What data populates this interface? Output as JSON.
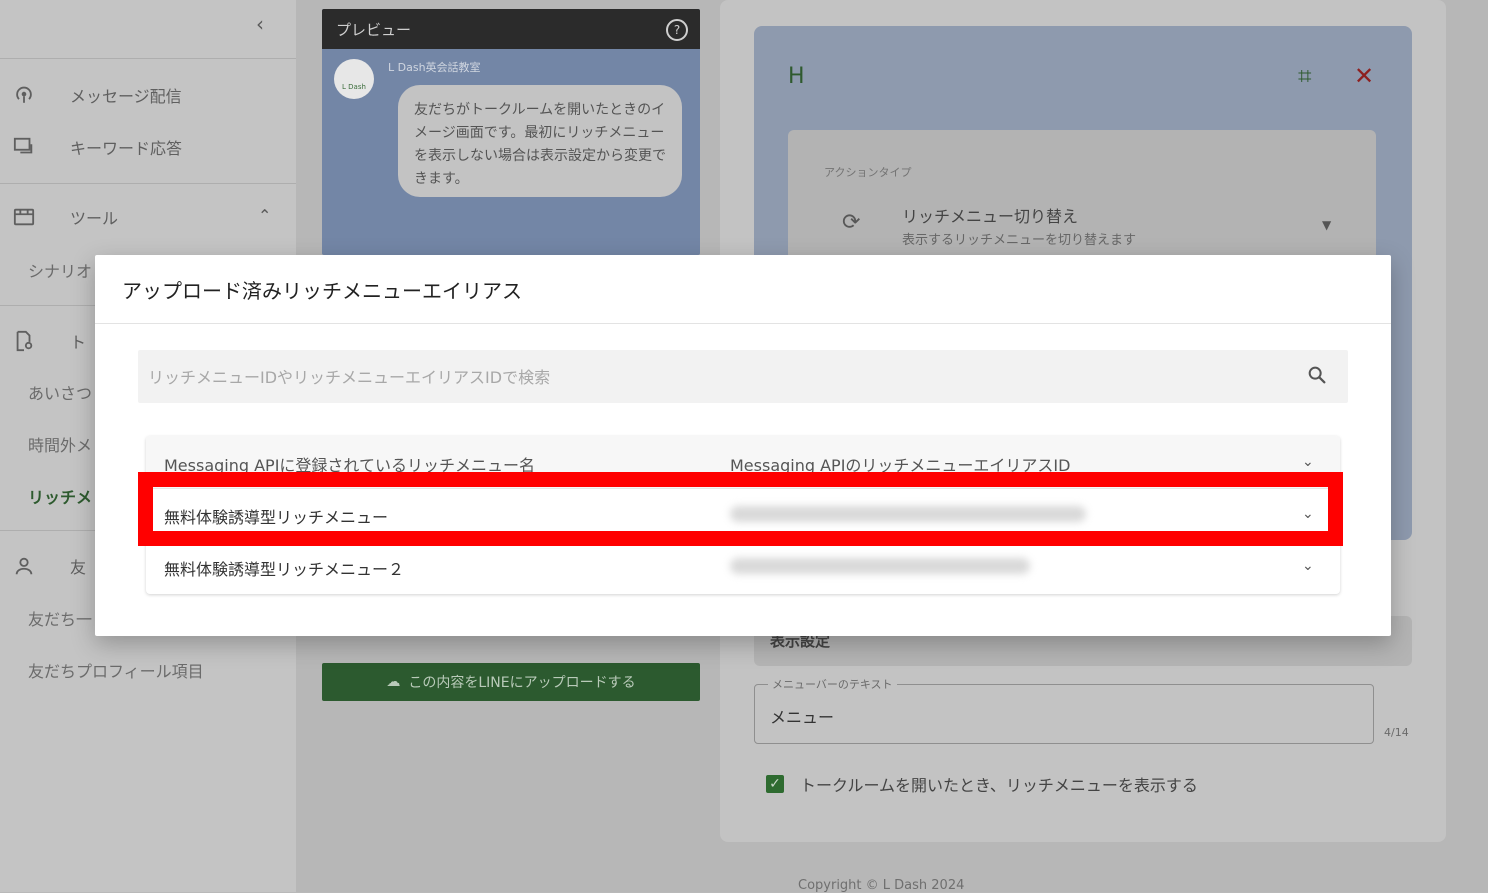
{
  "sidebar": {
    "collapse_icon": "chevron-left-icon",
    "items": [
      {
        "label": "メッセージ配信",
        "icon": "broadcast-icon"
      },
      {
        "label": "キーワード応答",
        "icon": "chat-reply-icon"
      },
      {
        "label": "ツール",
        "icon": "toolbox-icon"
      }
    ],
    "sub_items": {
      "scenario": "シナリオ",
      "talk_section_icon": "settings-doc-icon",
      "talk_section_partial": "ト",
      "greeting": "あいさつ",
      "after_hours": "時間外メ",
      "richmenu": "リッチメ",
      "friends_icon": "person-icon",
      "friends_partial": "友",
      "friends_list": "友だち一",
      "friend_profile": "友だちプロフィール項目"
    }
  },
  "preview": {
    "title": "プレビュー",
    "help_icon": "help-circle-icon",
    "bot_name": "L Dash英会話教室",
    "avatar_text": "L Dash",
    "bubble_text": "友だちがトークルームを開いたときのイメージ画面です。最初にリッチメニューを表示しない場合は表示設定から変更できます。",
    "upload_label": "この内容をLINEにアップロードする",
    "upload_icon": "cloud-upload-icon"
  },
  "action_panel": {
    "area_letter": "H",
    "crop_icon": "crop-icon",
    "close_icon": "close-icon",
    "action_type_label": "アクションタイプ",
    "action_title": "リッチメニュー切り替え",
    "action_desc": "表示するリッチメニューを切り替えます",
    "action_icon": "refresh-icon"
  },
  "display_settings": {
    "section_label": "表示設定",
    "menubar_label": "メニューバーのテキスト",
    "menubar_value": "メニュー",
    "counter": "4/14",
    "checkbox_label": "トークルームを開いたとき、リッチメニューを表示する",
    "checkbox_checked": true
  },
  "footer": {
    "copyright": "Copyright © L Dash 2024"
  },
  "dialog": {
    "title": "アップロード済みリッチメニューエイリアス",
    "search_placeholder": "リッチメニューIDやリッチメニューエイリアスIDで検索",
    "search_value": "",
    "search_icon": "search-icon",
    "columns": [
      "Messaging APIに登録されているリッチメニュー名",
      "Messaging APIのリッチメニューエイリアスID"
    ],
    "rows": [
      {
        "name": "無料体験誘導型リッチメニュー"
      },
      {
        "name": "無料体験誘導型リッチメニュー２"
      }
    ]
  },
  "colors": {
    "brand_green": "#2c5a2f",
    "highlight_red": "#ff0000",
    "close_red": "#8e2020"
  }
}
